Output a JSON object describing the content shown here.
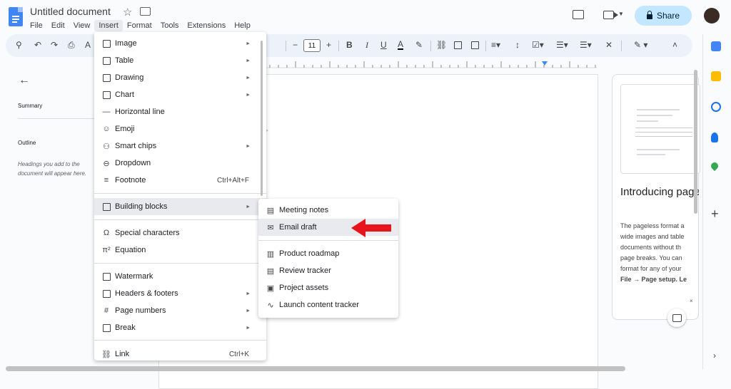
{
  "title": "Untitled document",
  "menubar": [
    "File",
    "Edit",
    "View",
    "Insert",
    "Format",
    "Tools",
    "Extensions",
    "Help"
  ],
  "share": {
    "label": "Share"
  },
  "toolbar": {
    "font_size": "11",
    "font_size_minus": "−",
    "font_size_plus": "+",
    "bold": "B",
    "italic": "I",
    "underline": "U",
    "text_color": "A"
  },
  "left_panel": {
    "summary": "Summary",
    "outline": "Outline",
    "outline_hint": "Headings you add to the document will appear here."
  },
  "promo": {
    "title": "Introducing pageless format",
    "body_lines": [
      "The pageless format a",
      "wide images and table",
      "documents without th",
      "page breaks. You can",
      "format for any of your"
    ],
    "setup_text": "File → Page setup. Le",
    "close": "×"
  },
  "insert_menu": {
    "items": [
      {
        "label": "Image",
        "icon": "image-icon",
        "submenu": true
      },
      {
        "label": "Table",
        "icon": "table-icon",
        "submenu": true
      },
      {
        "label": "Drawing",
        "icon": "drawing-icon",
        "submenu": true
      },
      {
        "label": "Chart",
        "icon": "chart-icon",
        "submenu": true
      },
      {
        "label": "Horizontal line",
        "icon": "horizontal-line-icon",
        "submenu": false
      },
      {
        "label": "Emoji",
        "icon": "emoji-icon",
        "submenu": false
      },
      {
        "label": "Smart chips",
        "icon": "smart-chips-icon",
        "submenu": true
      },
      {
        "label": "Dropdown",
        "icon": "dropdown-icon",
        "submenu": false
      },
      {
        "label": "Footnote",
        "icon": "footnote-icon",
        "submenu": false,
        "shortcut": "Ctrl+Alt+F"
      },
      {
        "label": "Building blocks",
        "icon": "building-blocks-icon",
        "submenu": true,
        "highlighted": true
      },
      {
        "label": "Special characters",
        "icon": "omega-icon",
        "submenu": false
      },
      {
        "label": "Equation",
        "icon": "pi-icon",
        "submenu": false
      },
      {
        "label": "Watermark",
        "icon": "watermark-icon",
        "submenu": false
      },
      {
        "label": "Headers & footers",
        "icon": "headers-footers-icon",
        "submenu": true
      },
      {
        "label": "Page numbers",
        "icon": "hash-icon",
        "submenu": true
      },
      {
        "label": "Break",
        "icon": "break-icon",
        "submenu": true
      },
      {
        "label": "Link",
        "icon": "link-icon",
        "submenu": false,
        "shortcut": "Ctrl+K"
      }
    ]
  },
  "building_blocks_menu": {
    "items": [
      {
        "label": "Meeting notes",
        "icon": "document-icon"
      },
      {
        "label": "Email draft",
        "icon": "email-icon",
        "highlighted": true
      },
      {
        "label": "Product roadmap",
        "icon": "roadmap-icon"
      },
      {
        "label": "Review tracker",
        "icon": "review-icon"
      },
      {
        "label": "Project assets",
        "icon": "assets-icon"
      },
      {
        "label": "Launch content tracker",
        "icon": "trending-icon"
      }
    ]
  },
  "colors": {
    "share_bg": "#c2e7ff",
    "toolbar_bg": "#edf2fa",
    "doc_icon": "#4285f4",
    "arrow": "#e8141b",
    "highlight": "#e8eaed"
  }
}
